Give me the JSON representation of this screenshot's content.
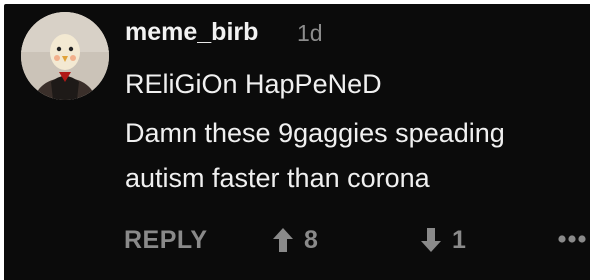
{
  "comment": {
    "username": "meme_birb",
    "timestamp": "1d",
    "lines": [
      "REliGiOn HapPeNeD",
      "Damn these 9gaggies speading",
      "autism faster than corona"
    ],
    "actions": {
      "reply_label": "REPLY",
      "upvote_count": "8",
      "downvote_count": "1",
      "upvote_icon": "arrow-up-icon",
      "downvote_icon": "arrow-down-icon",
      "more_icon": "more-horizontal-icon"
    }
  },
  "colors": {
    "background": "#0b0b0b",
    "text_primary": "#f0f0f0",
    "text_muted": "#8a8a8a",
    "timestamp": "#8c8c8c"
  }
}
